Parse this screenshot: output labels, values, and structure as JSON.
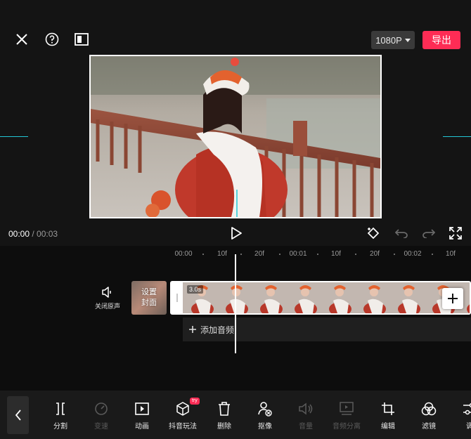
{
  "header": {
    "resolution": "1080P",
    "export_label": "导出"
  },
  "player": {
    "current_time": "00:00",
    "separator": " / ",
    "total_time": "00:03"
  },
  "ruler": [
    "00:00",
    "10f",
    "20f",
    "00:01",
    "10f",
    "20f",
    "00:02",
    "10f"
  ],
  "track": {
    "mute_label": "关闭原声",
    "cover_line1": "设置",
    "cover_line2": "封面",
    "clip_duration": "3.0s",
    "add_audio_label": "添加音频"
  },
  "toolbar": {
    "try_badge": "try",
    "tools": [
      {
        "label": "分割",
        "icon": "split-icon",
        "enabled": true
      },
      {
        "label": "变速",
        "icon": "speed-icon",
        "enabled": false
      },
      {
        "label": "动画",
        "icon": "animation-icon",
        "enabled": true
      },
      {
        "label": "抖音玩法",
        "icon": "cube-icon",
        "enabled": true
      },
      {
        "label": "删除",
        "icon": "trash-icon",
        "enabled": true
      },
      {
        "label": "抠像",
        "icon": "cutout-icon",
        "enabled": true
      },
      {
        "label": "音量",
        "icon": "volume-icon",
        "enabled": false
      },
      {
        "label": "音频分离",
        "icon": "audio-separate-icon",
        "enabled": false
      },
      {
        "label": "编辑",
        "icon": "crop-icon",
        "enabled": true
      },
      {
        "label": "滤镜",
        "icon": "filter-icon",
        "enabled": true
      },
      {
        "label": "调",
        "icon": "adjust-icon",
        "enabled": true
      }
    ]
  },
  "colors": {
    "accent": "#fe2c55",
    "guide": "#22c7d6",
    "background": "#0d0d0d"
  }
}
